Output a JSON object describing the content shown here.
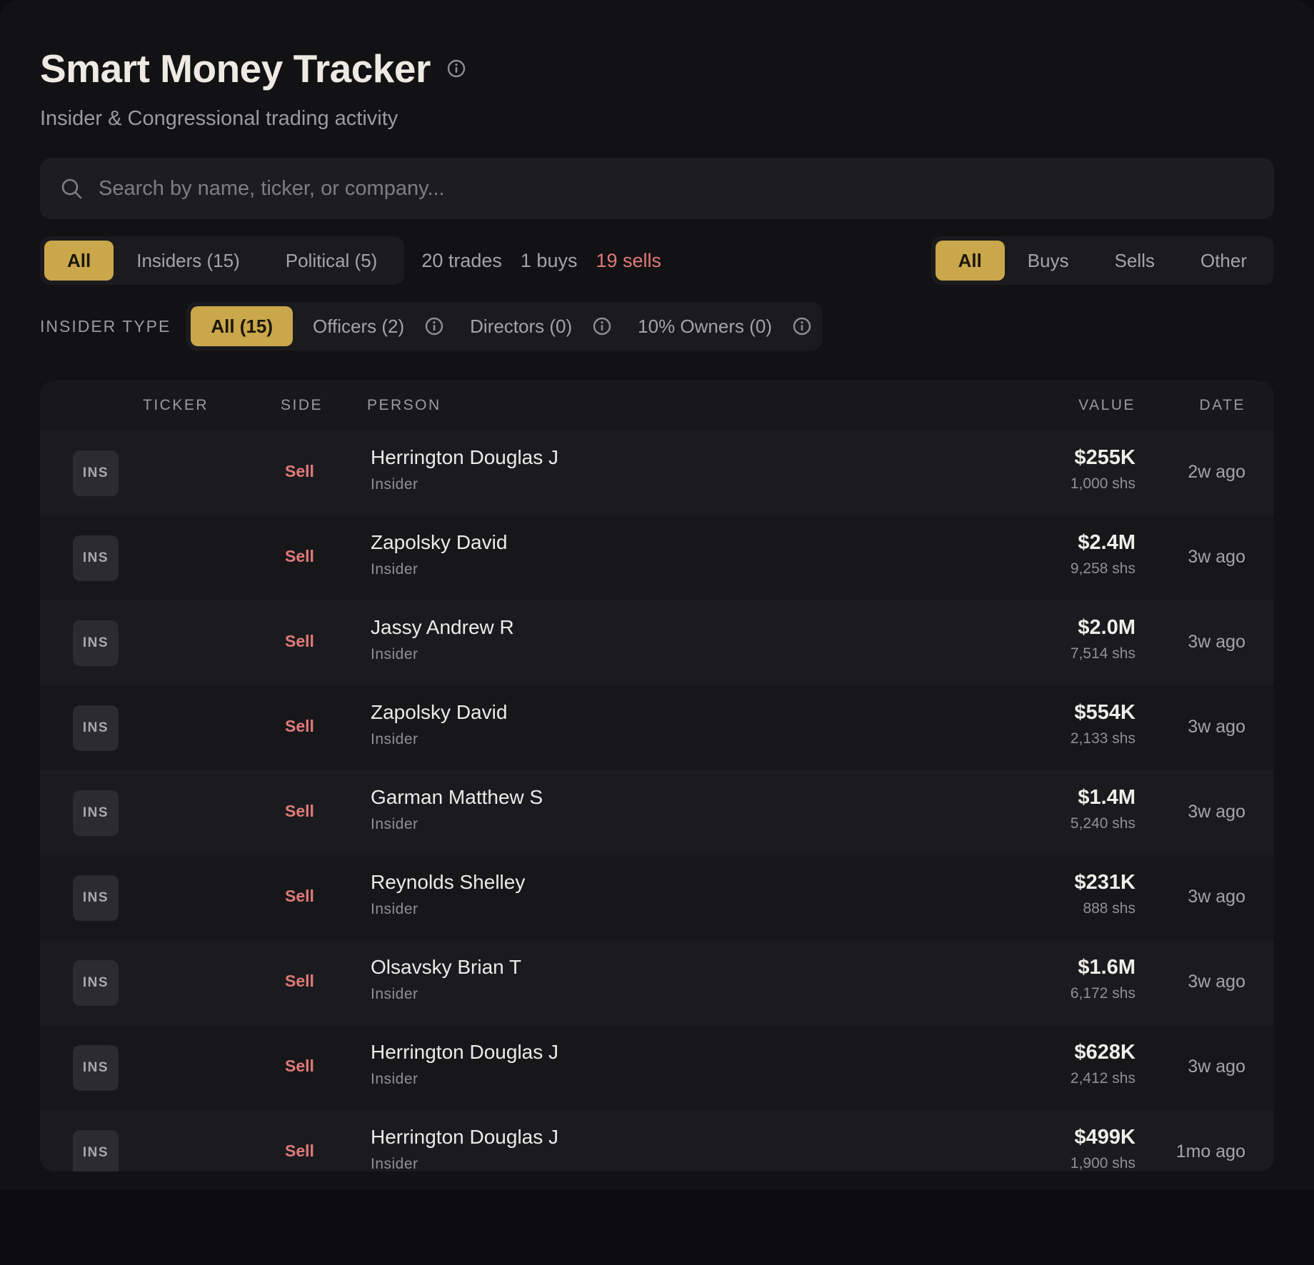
{
  "header": {
    "title": "Smart Money Tracker",
    "subtitle": "Insider & Congressional trading activity"
  },
  "search": {
    "placeholder": "Search by name, ticker, or company..."
  },
  "source_filter": {
    "tabs": [
      {
        "label": "All"
      },
      {
        "label": "Insiders (15)"
      },
      {
        "label": "Political (5)"
      }
    ]
  },
  "stats": {
    "trades": "20 trades",
    "buys": "1 buys",
    "sells": "19 sells"
  },
  "side_filter": {
    "tabs": [
      {
        "label": "All"
      },
      {
        "label": "Buys"
      },
      {
        "label": "Sells"
      },
      {
        "label": "Other"
      }
    ]
  },
  "insider_type": {
    "label": "INSIDER TYPE",
    "tabs": [
      {
        "label": "All (15)"
      },
      {
        "label": "Officers (2)"
      },
      {
        "label": "Directors (0)"
      },
      {
        "label": "10% Owners (0)"
      }
    ]
  },
  "table": {
    "columns": {
      "ticker": "TICKER",
      "side": "SIDE",
      "person": "PERSON",
      "value": "VALUE",
      "date": "DATE"
    },
    "rows": [
      {
        "badge": "INS",
        "side": "Sell",
        "name": "Herrington Douglas J",
        "role": "Insider",
        "value": "$255K",
        "shares": "1,000 shs",
        "date": "2w ago"
      },
      {
        "badge": "INS",
        "side": "Sell",
        "name": "Zapolsky David",
        "role": "Insider",
        "value": "$2.4M",
        "shares": "9,258 shs",
        "date": "3w ago"
      },
      {
        "badge": "INS",
        "side": "Sell",
        "name": "Jassy Andrew R",
        "role": "Insider",
        "value": "$2.0M",
        "shares": "7,514 shs",
        "date": "3w ago"
      },
      {
        "badge": "INS",
        "side": "Sell",
        "name": "Zapolsky David",
        "role": "Insider",
        "value": "$554K",
        "shares": "2,133 shs",
        "date": "3w ago"
      },
      {
        "badge": "INS",
        "side": "Sell",
        "name": "Garman Matthew S",
        "role": "Insider",
        "value": "$1.4M",
        "shares": "5,240 shs",
        "date": "3w ago"
      },
      {
        "badge": "INS",
        "side": "Sell",
        "name": "Reynolds Shelley",
        "role": "Insider",
        "value": "$231K",
        "shares": "888 shs",
        "date": "3w ago"
      },
      {
        "badge": "INS",
        "side": "Sell",
        "name": "Olsavsky Brian T",
        "role": "Insider",
        "value": "$1.6M",
        "shares": "6,172 shs",
        "date": "3w ago"
      },
      {
        "badge": "INS",
        "side": "Sell",
        "name": "Herrington Douglas J",
        "role": "Insider",
        "value": "$628K",
        "shares": "2,412 shs",
        "date": "3w ago"
      },
      {
        "badge": "INS",
        "side": "Sell",
        "name": "Herrington Douglas J",
        "role": "Insider",
        "value": "$499K",
        "shares": "1,900 shs",
        "date": "1mo ago"
      }
    ]
  },
  "colors": {
    "accent": "#c9a74a",
    "sell": "#e07a78",
    "background": "#121214"
  }
}
